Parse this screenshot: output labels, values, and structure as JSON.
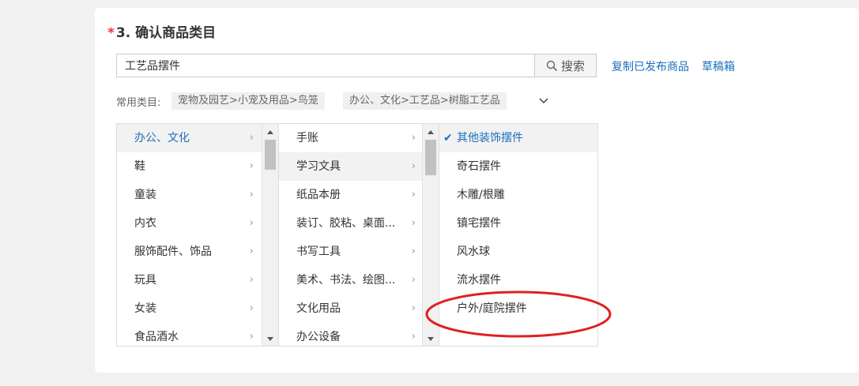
{
  "section": {
    "required_mark": "*",
    "title": "3. 确认商品类目"
  },
  "search": {
    "value": "工艺品摆件",
    "button_label": "搜索"
  },
  "links": {
    "copy_published": "复制已发布商品",
    "drafts": "草稿箱"
  },
  "common_categories": {
    "label": "常用类目:",
    "items": [
      "宠物及园艺>小宠及用品>鸟笼",
      "办公、文化>工艺品>树脂工艺品"
    ]
  },
  "columns": {
    "level1": [
      {
        "label": "办公、文化",
        "selected": true
      },
      {
        "label": "鞋"
      },
      {
        "label": "童装"
      },
      {
        "label": "内衣"
      },
      {
        "label": "服饰配件、饰品"
      },
      {
        "label": "玩具"
      },
      {
        "label": "女装"
      },
      {
        "label": "食品酒水"
      }
    ],
    "level2": [
      {
        "label": "手账"
      },
      {
        "label": "学习文具",
        "selected": true
      },
      {
        "label": "纸品本册"
      },
      {
        "label": "装订、胶粘、桌面..."
      },
      {
        "label": "书写工具"
      },
      {
        "label": "美术、书法、绘图..."
      },
      {
        "label": "文化用品"
      },
      {
        "label": "办公设备"
      }
    ],
    "level3": [
      {
        "label": "其他装饰摆件",
        "selected": true
      },
      {
        "label": "奇石摆件"
      },
      {
        "label": "木雕/根雕"
      },
      {
        "label": "镇宅摆件"
      },
      {
        "label": "风水球"
      },
      {
        "label": "流水摆件"
      },
      {
        "label": "户外/庭院摆件",
        "highlighted": true
      }
    ]
  },
  "icons": {
    "arrow": "›",
    "check": "✔"
  },
  "colors": {
    "link": "#1a6fbd",
    "required": "#e4393c",
    "highlight_circle": "#e02020"
  }
}
